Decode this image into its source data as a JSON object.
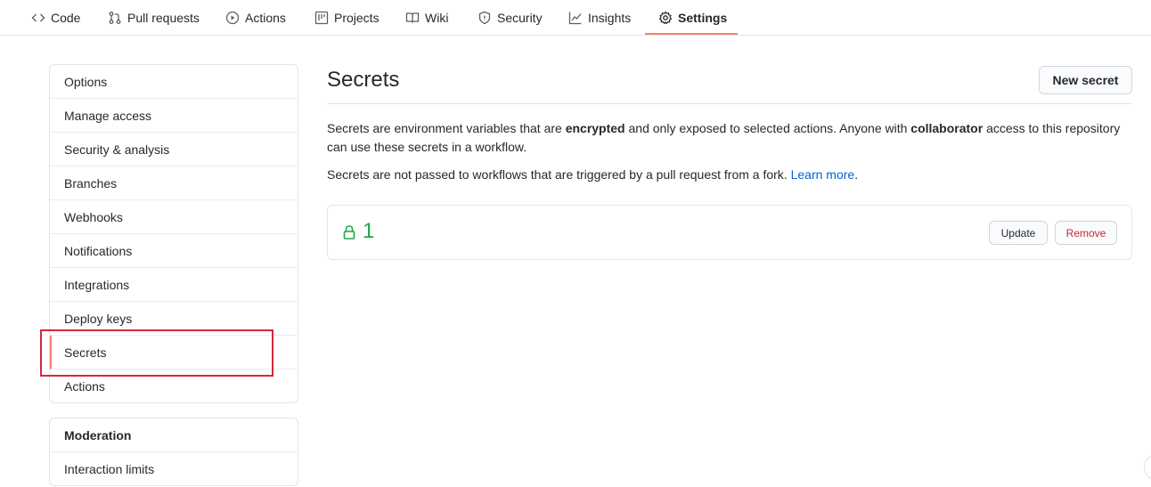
{
  "nav": {
    "tabs": [
      {
        "label": "Code",
        "icon": "code-icon"
      },
      {
        "label": "Pull requests",
        "icon": "pull-request-icon"
      },
      {
        "label": "Actions",
        "icon": "play-icon"
      },
      {
        "label": "Projects",
        "icon": "project-icon"
      },
      {
        "label": "Wiki",
        "icon": "book-icon"
      },
      {
        "label": "Security",
        "icon": "shield-icon"
      },
      {
        "label": "Insights",
        "icon": "graph-icon"
      },
      {
        "label": "Settings",
        "icon": "gear-icon",
        "selected": true
      }
    ]
  },
  "sidebar": {
    "items": [
      {
        "label": "Options"
      },
      {
        "label": "Manage access"
      },
      {
        "label": "Security & analysis"
      },
      {
        "label": "Branches"
      },
      {
        "label": "Webhooks"
      },
      {
        "label": "Notifications"
      },
      {
        "label": "Integrations"
      },
      {
        "label": "Deploy keys"
      },
      {
        "label": "Secrets",
        "selected": true
      },
      {
        "label": "Actions"
      }
    ],
    "moderation": {
      "heading": "Moderation",
      "items": [
        {
          "label": "Interaction limits"
        }
      ]
    }
  },
  "main": {
    "title": "Secrets",
    "new_secret_label": "New secret",
    "desc1": {
      "part1": "Secrets are environment variables that are ",
      "bold1": "encrypted",
      "part2": " and only exposed to selected actions. Anyone with ",
      "bold2": "collaborator",
      "part3": " access to this repository can use these secrets in a workflow."
    },
    "desc2": {
      "text": "Secrets are not passed to workflows that are triggered by a pull request from a fork. ",
      "link": "Learn more",
      "end": "."
    },
    "secrets": [
      {
        "name": "1",
        "update_label": "Update",
        "remove_label": "Remove"
      }
    ]
  },
  "colors": {
    "accent": "#f9826c",
    "secret_green": "#22a646",
    "remove_red": "#cb2431",
    "link_blue": "#0366d6",
    "highlight_red": "#d7263d"
  }
}
